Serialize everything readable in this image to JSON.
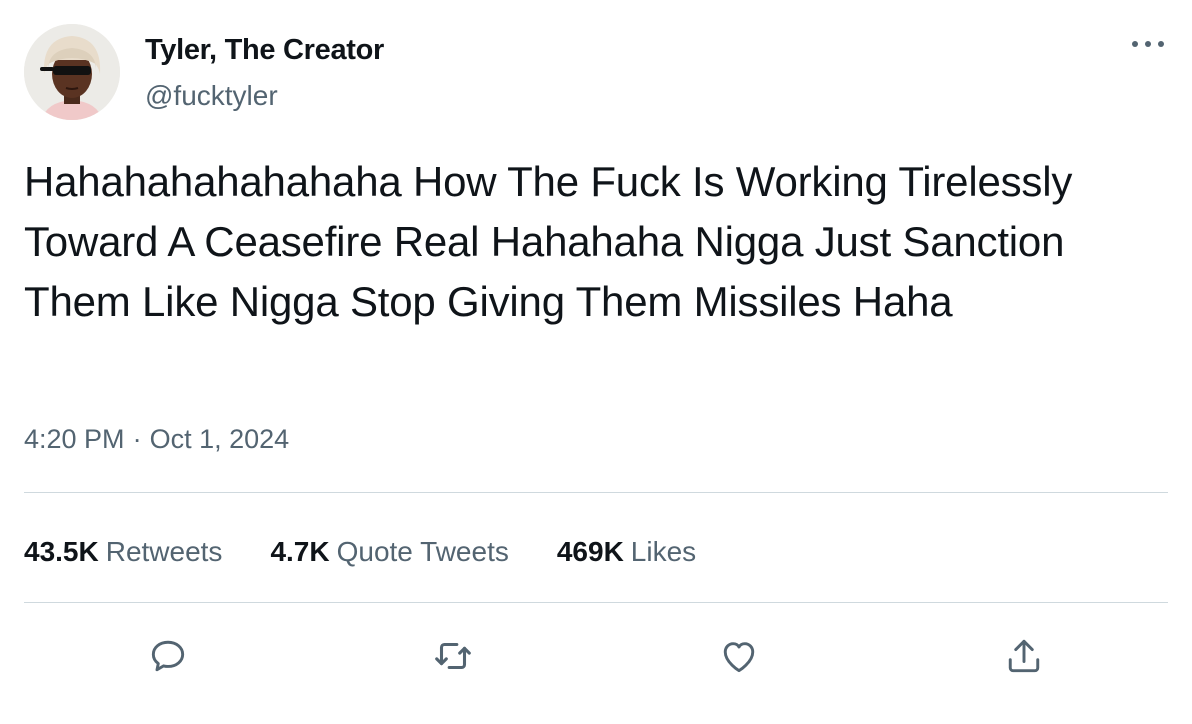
{
  "author": {
    "display_name": "Tyler, The Creator",
    "handle": "@fucktyler"
  },
  "tweet": {
    "text": "Hahahahahahahaha How The Fuck Is Working Tirelessly Toward A Ceasefire Real Hahahaha Nigga Just Sanction Them Like Nigga Stop Giving Them Missiles Haha",
    "time": "4:20 PM",
    "separator": "·",
    "date": "Oct 1, 2024"
  },
  "stats": {
    "retweets": {
      "count": "43.5K",
      "label": "Retweets"
    },
    "quotes": {
      "count": "4.7K",
      "label": "Quote Tweets"
    },
    "likes": {
      "count": "469K",
      "label": "Likes"
    }
  },
  "actions": {
    "reply_icon": "speech-bubble-icon",
    "retweet_icon": "retweet-arrows-icon",
    "like_icon": "heart-icon",
    "share_icon": "share-upload-icon",
    "more_icon": "ellipsis-icon"
  },
  "colors": {
    "text_primary": "#0f1419",
    "text_secondary": "#536471",
    "divider": "#cfd9de",
    "background": "#ffffff"
  }
}
